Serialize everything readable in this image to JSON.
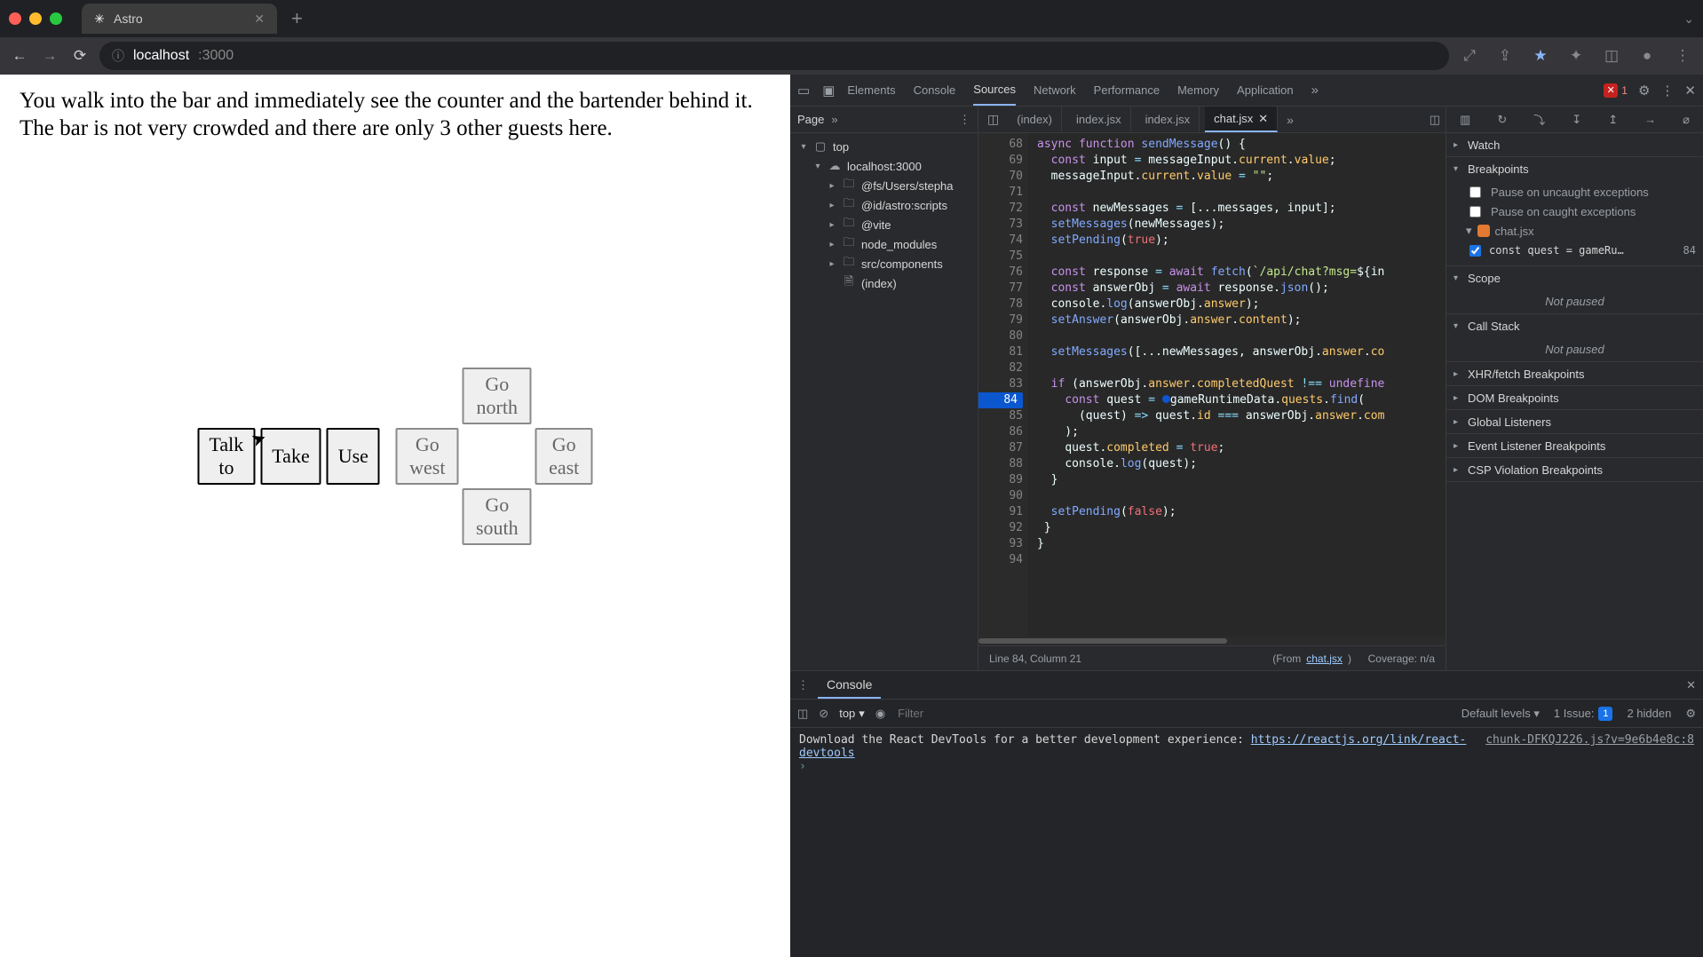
{
  "browser": {
    "tab_title": "Astro",
    "url_host": "localhost",
    "url_path": ":3000"
  },
  "page": {
    "text": "You walk into the bar and immediately see the counter and the bartender behind it. The bar is not very crowded and there are only 3 other guests here.",
    "actions": {
      "talk": "Talk to",
      "take": "Take",
      "use": "Use"
    },
    "nav": {
      "north": "Go north",
      "west": "Go west",
      "east": "Go east",
      "south": "Go south"
    }
  },
  "devtools": {
    "tabs": [
      "Elements",
      "Console",
      "Sources",
      "Network",
      "Performance",
      "Memory",
      "Application"
    ],
    "active_tab": "Sources",
    "error_count": "1",
    "nav": {
      "mode": "Page",
      "tree": {
        "top": "top",
        "origin": "localhost:3000",
        "folders": [
          "@fs/Users/stepha",
          "@id/astro:scripts",
          "@vite",
          "node_modules",
          "src/components"
        ],
        "file": "(index)"
      }
    },
    "editor": {
      "tabs": [
        "(index)",
        "index.jsx",
        "index.jsx",
        "chat.jsx"
      ],
      "active": "chat.jsx",
      "first_line": 68,
      "bp_line": 84,
      "status_left": "Line 84, Column 21",
      "status_from_label": "(From ",
      "status_from_file": "chat.jsx",
      "status_from_suffix": ")",
      "status_cov": "Coverage: n/a"
    },
    "debug": {
      "watch": "Watch",
      "breakpoints": "Breakpoints",
      "bp_uncaught": "Pause on uncaught exceptions",
      "bp_caught": "Pause on caught exceptions",
      "bp_file": "chat.jsx",
      "bp_code": "const quest = gameRu…",
      "bp_linenum": "84",
      "scope": "Scope",
      "not_paused": "Not paused",
      "callstack": "Call Stack",
      "xhr": "XHR/fetch Breakpoints",
      "dom": "DOM Breakpoints",
      "global": "Global Listeners",
      "event": "Event Listener Breakpoints",
      "csp": "CSP Violation Breakpoints"
    },
    "console": {
      "title": "Console",
      "context": "top",
      "filter_ph": "Filter",
      "levels": "Default levels",
      "issue_label": "1 Issue:",
      "issue_count": "1",
      "hidden": "2 hidden",
      "msg_src": "chunk-DFKQJ226.js?v=9e6b4e8c:8",
      "msg": "Download the React DevTools for a better development experience: ",
      "msg_link": "https://reactjs.org/link/react-devtools"
    }
  }
}
